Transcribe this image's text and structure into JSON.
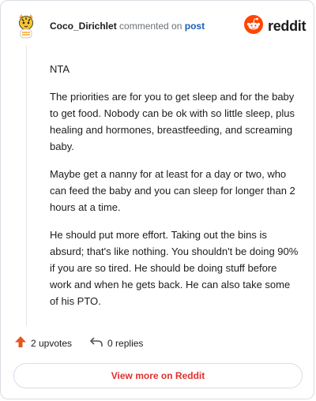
{
  "comment": {
    "username": "Coco_Dirichlet",
    "action_text": "commented on",
    "post_link": "post",
    "paragraphs": [
      "NTA",
      "The priorities are for you to get sleep and for the baby to get food. Nobody can be ok with so little sleep, plus healing and hormones, breastfeeding, and screaming baby.",
      "Maybe get a nanny for at least for a day or two, who can feed the baby and you can sleep for longer than 2 hours at a time.",
      "He should put more effort. Taking out the bins is absurd; that's like nothing. You shouldn't be doing 90% if you are so tired. He should be doing stuff before work and when he gets back. He can also take some of his PTO."
    ]
  },
  "brand": {
    "name": "reddit",
    "color": "#ff4500"
  },
  "actions": {
    "upvotes": "2 upvotes",
    "replies": "0 replies"
  },
  "footer": {
    "view_more": "View more on Reddit"
  },
  "icons": {
    "avatar": "tiger-avatar-icon",
    "logo": "reddit-alien-icon",
    "upvote": "upvote-arrow-icon",
    "reply": "reply-arrow-icon"
  },
  "colors": {
    "upvote": "#e4571f",
    "view_more": "#e0302c",
    "link": "#1a5fb4"
  }
}
